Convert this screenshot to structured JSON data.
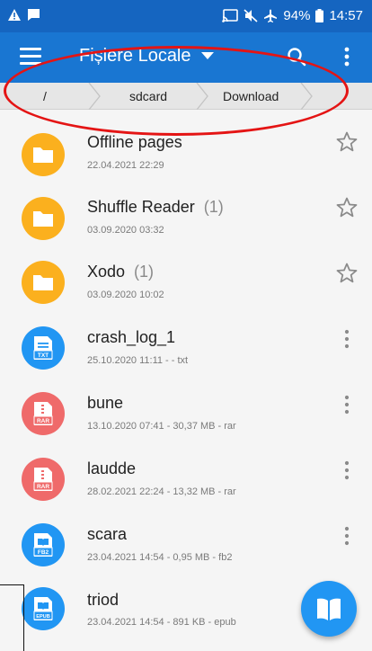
{
  "status_bar": {
    "battery": "94%",
    "time": "14:57",
    "left_icons": [
      "warning-icon",
      "message-icon"
    ],
    "right_icons": [
      "cast-icon",
      "mute-icon",
      "airplane-icon",
      "battery-icon"
    ]
  },
  "app_bar": {
    "title": "Fișiere Locale",
    "icons": [
      "menu-icon",
      "caret-down-icon",
      "search-icon",
      "more-vert-icon"
    ]
  },
  "breadcrumb": [
    "/",
    "sdcard",
    "Download"
  ],
  "files": [
    {
      "name": "Offline pages",
      "count": "",
      "meta": "22.04.2021 22:29",
      "icon": "folder-icon",
      "action": "star-icon"
    },
    {
      "name": "Shuffle Reader",
      "count": "(1)",
      "meta": "03.09.2020 03:32",
      "icon": "folder-icon",
      "action": "star-icon"
    },
    {
      "name": "Xodo",
      "count": "(1)",
      "meta": "03.09.2020 10:02",
      "icon": "folder-icon",
      "action": "star-icon"
    },
    {
      "name": "crash_log_1",
      "count": "",
      "meta": "25.10.2020 11:11 - - txt",
      "icon": "txt-file-icon",
      "icon_label": "TXT",
      "action": "more-vert-icon"
    },
    {
      "name": "bune",
      "count": "",
      "meta": "13.10.2020 07:41 - 30,37 MB - rar",
      "icon": "rar-file-icon",
      "icon_label": "RAR",
      "action": "more-vert-icon"
    },
    {
      "name": "laudde",
      "count": "",
      "meta": "28.02.2021 22:24 - 13,32 MB - rar",
      "icon": "rar-file-icon",
      "icon_label": "RAR",
      "action": "more-vert-icon"
    },
    {
      "name": "scara",
      "count": "",
      "meta": "23.04.2021 14:54 - 0,95 MB - fb2",
      "icon": "fb2-file-icon",
      "icon_label": "FB2",
      "action": "more-vert-icon"
    },
    {
      "name": "triod",
      "count": "",
      "meta": "23.04.2021 14:54 - 891 KB - epub",
      "icon": "epub-file-icon",
      "icon_label": "EPUB",
      "action": "more-vert-icon"
    }
  ],
  "fab": {
    "icon": "open-book-icon"
  },
  "colors": {
    "status_bar": "#1565c0",
    "app_bar": "#1976d2",
    "folder": "#fbb01e",
    "blue_file": "#2196f3",
    "red_file": "#ef6a6a",
    "annotation_oval": "#e41414"
  }
}
